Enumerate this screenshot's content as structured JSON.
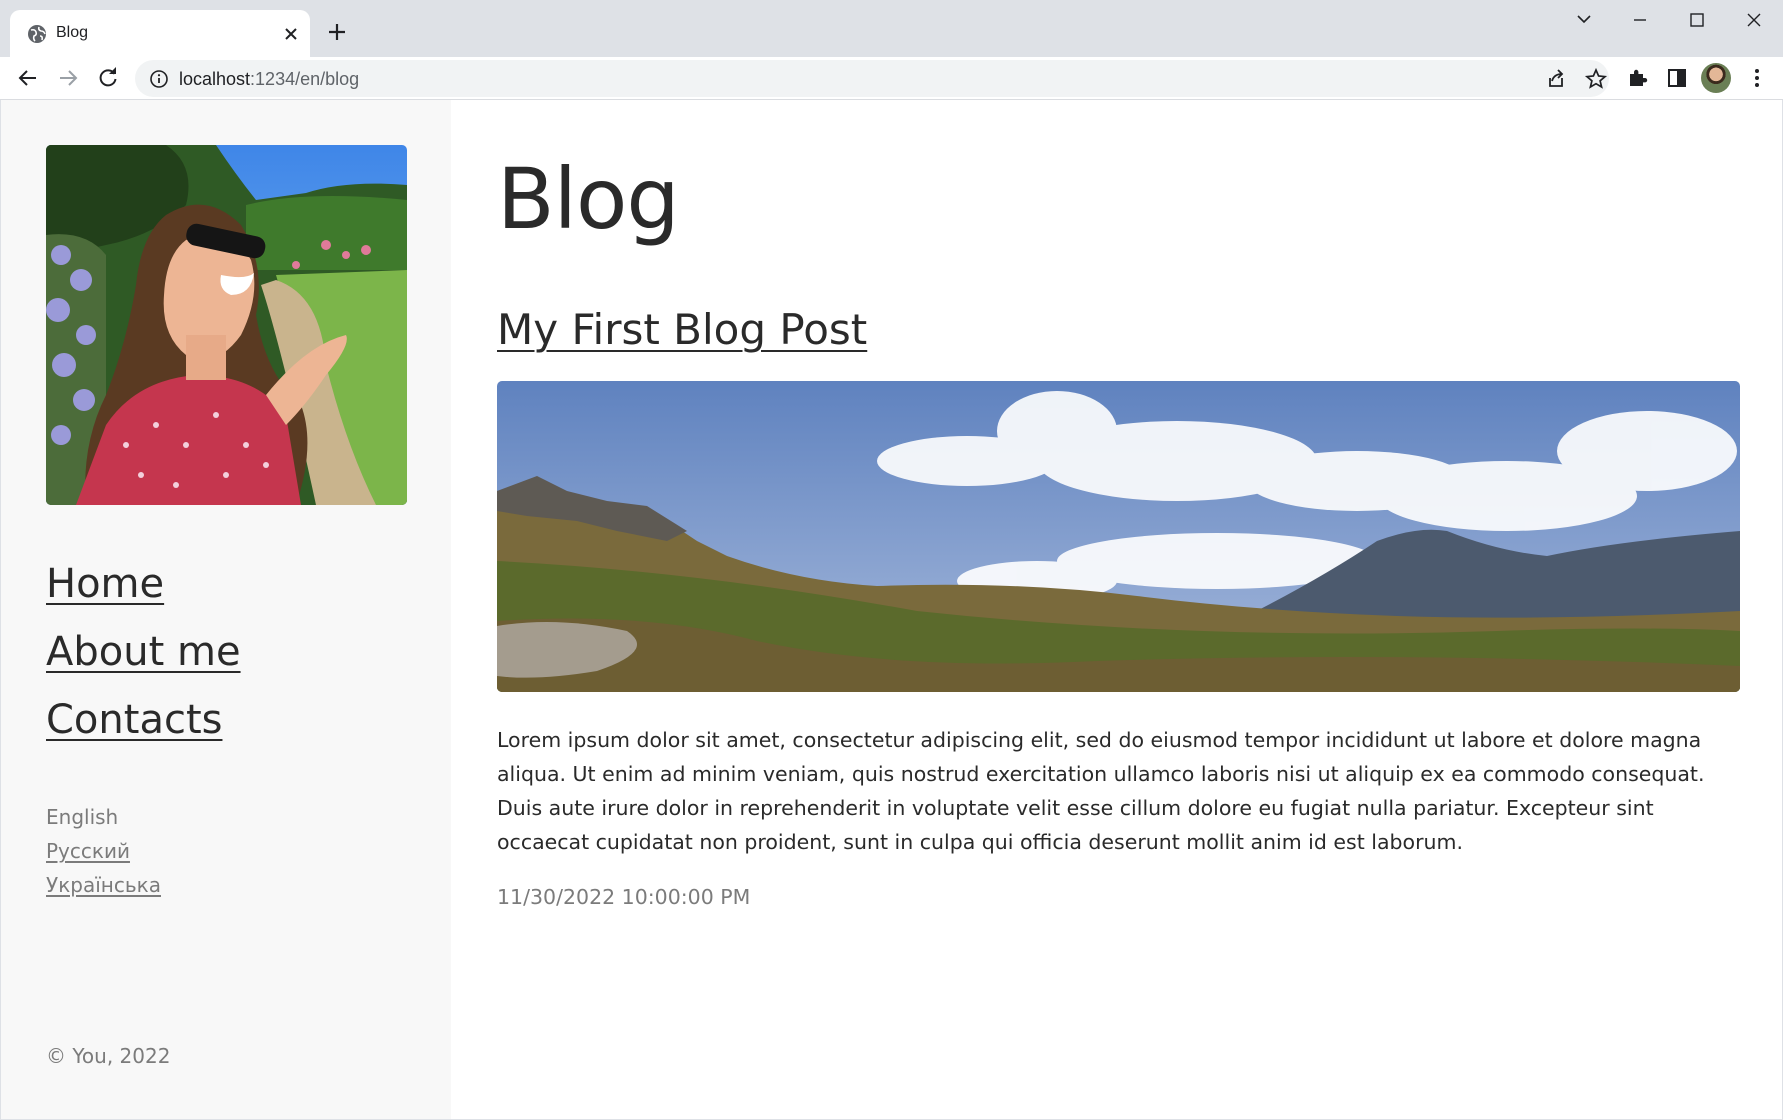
{
  "browser": {
    "tab_title": "Blog",
    "url_host": "localhost",
    "url_path": ":1234/en/blog"
  },
  "sidebar": {
    "nav": [
      {
        "label": "Home"
      },
      {
        "label": "About me"
      },
      {
        "label": "Contacts"
      }
    ],
    "languages": {
      "current": "English",
      "others": [
        "Русский",
        "Українська"
      ]
    },
    "copyright": "© You, 2022"
  },
  "main": {
    "page_title": "Blog",
    "post": {
      "title": "My First Blog Post",
      "body": "Lorem ipsum dolor sit amet, consectetur adipiscing elit, sed do eiusmod tempor incididunt ut labore et dolore magna aliqua. Ut enim ad minim veniam, quis nostrud exercitation ullamco laboris nisi ut aliquip ex ea commodo consequat. Duis aute irure dolor in reprehenderit in voluptate velit esse cillum dolore eu fugiat nulla pariatur. Excepteur sint occaecat cupidatat non proident, sunt in culpa qui officia deserunt mollit anim id est laborum.",
      "date": "11/30/2022 10:00:00 PM"
    }
  },
  "icons": {
    "tab_favicon": "globe-icon",
    "tab_close": "close-icon",
    "new_tab": "plus-icon",
    "back": "back-arrow-icon",
    "forward": "forward-arrow-icon",
    "reload": "reload-icon",
    "site_info": "info-icon",
    "share": "share-icon",
    "bookmark": "star-icon",
    "extensions": "puzzle-icon",
    "side_panel": "side-panel-icon",
    "menu": "kebab-menu-icon"
  },
  "colors": {
    "text": "#2a2a2a",
    "muted": "#7b7b7b",
    "sidebar_bg": "#f8f8f8",
    "chrome_bg": "#dee1e6"
  }
}
